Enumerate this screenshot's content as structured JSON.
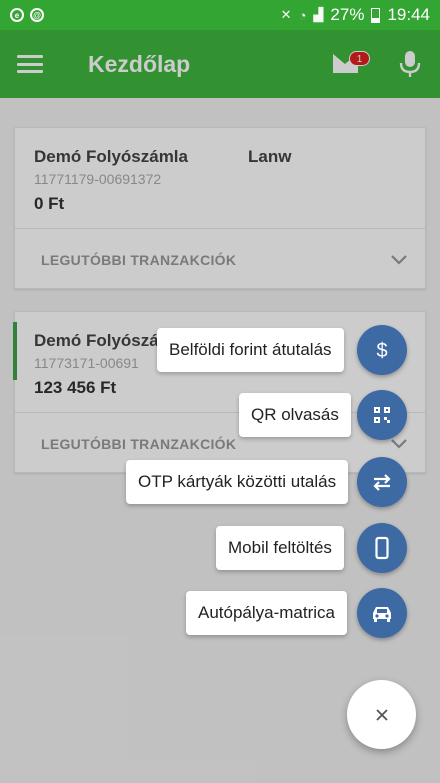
{
  "status_bar": {
    "battery_percent": "27%",
    "time": "19:44"
  },
  "app_bar": {
    "title": "Kezdőlap",
    "mail_badge_count": "1"
  },
  "accounts": [
    {
      "name": "Demó Folyószámla",
      "tag": "Lanw",
      "number": "11771179-00691372",
      "balance": "0 Ft",
      "recent_label": "LEGUTÓBBI TRANZAKCIÓK"
    },
    {
      "name": "Demó Folyószámla",
      "tag": "",
      "number": "11773171-00691",
      "balance": "123 456 Ft",
      "recent_label": "LEGUTÓBBI TRANZAKCIÓK"
    }
  ],
  "fab_menu": {
    "items": [
      {
        "label": "Belföldi forint átutalás",
        "icon": "dollar-icon"
      },
      {
        "label": "QR olvasás",
        "icon": "qr-code-icon"
      },
      {
        "label": "OTP kártyák közötti utalás",
        "icon": "transfer-arrows-icon"
      },
      {
        "label": "Mobil feltöltés",
        "icon": "phone-icon"
      },
      {
        "label": "Autópálya-matrica",
        "icon": "car-icon"
      }
    ],
    "close_icon": "close-icon"
  },
  "colors": {
    "status_bar": "#33a532",
    "app_bar": "#3fb63e",
    "fab_mini": "#3d6aa2",
    "badge": "#e02020"
  }
}
